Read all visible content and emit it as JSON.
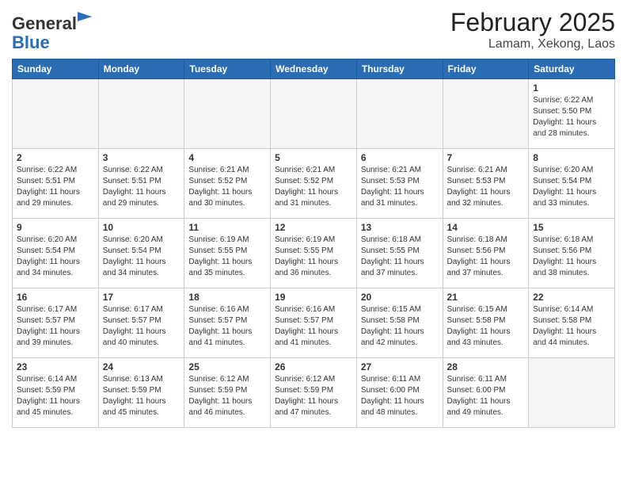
{
  "header": {
    "logo_general": "General",
    "logo_blue": "Blue",
    "month_year": "February 2025",
    "location": "Lamam, Xekong, Laos"
  },
  "weekdays": [
    "Sunday",
    "Monday",
    "Tuesday",
    "Wednesday",
    "Thursday",
    "Friday",
    "Saturday"
  ],
  "weeks": [
    [
      {
        "day": "",
        "info": ""
      },
      {
        "day": "",
        "info": ""
      },
      {
        "day": "",
        "info": ""
      },
      {
        "day": "",
        "info": ""
      },
      {
        "day": "",
        "info": ""
      },
      {
        "day": "",
        "info": ""
      },
      {
        "day": "1",
        "info": "Sunrise: 6:22 AM\nSunset: 5:50 PM\nDaylight: 11 hours\nand 28 minutes."
      }
    ],
    [
      {
        "day": "2",
        "info": "Sunrise: 6:22 AM\nSunset: 5:51 PM\nDaylight: 11 hours\nand 29 minutes."
      },
      {
        "day": "3",
        "info": "Sunrise: 6:22 AM\nSunset: 5:51 PM\nDaylight: 11 hours\nand 29 minutes."
      },
      {
        "day": "4",
        "info": "Sunrise: 6:21 AM\nSunset: 5:52 PM\nDaylight: 11 hours\nand 30 minutes."
      },
      {
        "day": "5",
        "info": "Sunrise: 6:21 AM\nSunset: 5:52 PM\nDaylight: 11 hours\nand 31 minutes."
      },
      {
        "day": "6",
        "info": "Sunrise: 6:21 AM\nSunset: 5:53 PM\nDaylight: 11 hours\nand 31 minutes."
      },
      {
        "day": "7",
        "info": "Sunrise: 6:21 AM\nSunset: 5:53 PM\nDaylight: 11 hours\nand 32 minutes."
      },
      {
        "day": "8",
        "info": "Sunrise: 6:20 AM\nSunset: 5:54 PM\nDaylight: 11 hours\nand 33 minutes."
      }
    ],
    [
      {
        "day": "9",
        "info": "Sunrise: 6:20 AM\nSunset: 5:54 PM\nDaylight: 11 hours\nand 34 minutes."
      },
      {
        "day": "10",
        "info": "Sunrise: 6:20 AM\nSunset: 5:54 PM\nDaylight: 11 hours\nand 34 minutes."
      },
      {
        "day": "11",
        "info": "Sunrise: 6:19 AM\nSunset: 5:55 PM\nDaylight: 11 hours\nand 35 minutes."
      },
      {
        "day": "12",
        "info": "Sunrise: 6:19 AM\nSunset: 5:55 PM\nDaylight: 11 hours\nand 36 minutes."
      },
      {
        "day": "13",
        "info": "Sunrise: 6:18 AM\nSunset: 5:55 PM\nDaylight: 11 hours\nand 37 minutes."
      },
      {
        "day": "14",
        "info": "Sunrise: 6:18 AM\nSunset: 5:56 PM\nDaylight: 11 hours\nand 37 minutes."
      },
      {
        "day": "15",
        "info": "Sunrise: 6:18 AM\nSunset: 5:56 PM\nDaylight: 11 hours\nand 38 minutes."
      }
    ],
    [
      {
        "day": "16",
        "info": "Sunrise: 6:17 AM\nSunset: 5:57 PM\nDaylight: 11 hours\nand 39 minutes."
      },
      {
        "day": "17",
        "info": "Sunrise: 6:17 AM\nSunset: 5:57 PM\nDaylight: 11 hours\nand 40 minutes."
      },
      {
        "day": "18",
        "info": "Sunrise: 6:16 AM\nSunset: 5:57 PM\nDaylight: 11 hours\nand 41 minutes."
      },
      {
        "day": "19",
        "info": "Sunrise: 6:16 AM\nSunset: 5:57 PM\nDaylight: 11 hours\nand 41 minutes."
      },
      {
        "day": "20",
        "info": "Sunrise: 6:15 AM\nSunset: 5:58 PM\nDaylight: 11 hours\nand 42 minutes."
      },
      {
        "day": "21",
        "info": "Sunrise: 6:15 AM\nSunset: 5:58 PM\nDaylight: 11 hours\nand 43 minutes."
      },
      {
        "day": "22",
        "info": "Sunrise: 6:14 AM\nSunset: 5:58 PM\nDaylight: 11 hours\nand 44 minutes."
      }
    ],
    [
      {
        "day": "23",
        "info": "Sunrise: 6:14 AM\nSunset: 5:59 PM\nDaylight: 11 hours\nand 45 minutes."
      },
      {
        "day": "24",
        "info": "Sunrise: 6:13 AM\nSunset: 5:59 PM\nDaylight: 11 hours\nand 45 minutes."
      },
      {
        "day": "25",
        "info": "Sunrise: 6:12 AM\nSunset: 5:59 PM\nDaylight: 11 hours\nand 46 minutes."
      },
      {
        "day": "26",
        "info": "Sunrise: 6:12 AM\nSunset: 5:59 PM\nDaylight: 11 hours\nand 47 minutes."
      },
      {
        "day": "27",
        "info": "Sunrise: 6:11 AM\nSunset: 6:00 PM\nDaylight: 11 hours\nand 48 minutes."
      },
      {
        "day": "28",
        "info": "Sunrise: 6:11 AM\nSunset: 6:00 PM\nDaylight: 11 hours\nand 49 minutes."
      },
      {
        "day": "",
        "info": ""
      }
    ]
  ]
}
